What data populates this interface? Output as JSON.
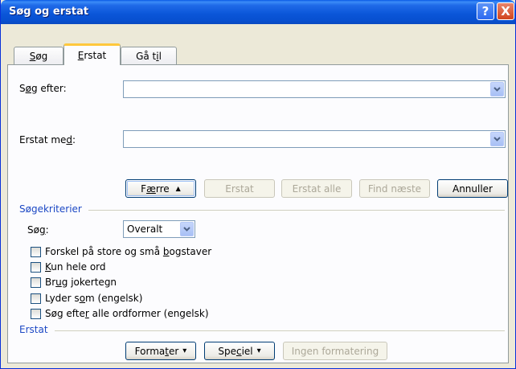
{
  "window": {
    "title": "Søg og erstat",
    "help_symbol": "?",
    "close_symbol": "X"
  },
  "tabs": [
    {
      "label_pre": "",
      "label_u": "S",
      "label_post": "øg"
    },
    {
      "label_pre": "",
      "label_u": "E",
      "label_post": "rstat"
    },
    {
      "label_pre": "Gå t",
      "label_u": "i",
      "label_post": "l"
    }
  ],
  "search": {
    "label_pre": "S",
    "label_u": "ø",
    "label_post": "g efter:",
    "value": ""
  },
  "replace": {
    "label_pre": "Erstat me",
    "label_u": "d",
    "label_post": ":",
    "value": ""
  },
  "buttons": {
    "less_pre": "F",
    "less_u": "æ",
    "less_post": "rre",
    "less_arrow": "▲",
    "replace": "Erstat",
    "replace_all": "Erstat alle",
    "find_next": "Find næste",
    "cancel": "Annuller"
  },
  "criteria": {
    "section_title": "Søgekriterier",
    "search_label_pre": "Sø",
    "search_label_u": "g",
    "search_label_post": ":",
    "search_direction": "Overalt",
    "options": [
      {
        "pre": "Forskel på store og små ",
        "u": "b",
        "post": "ogstaver",
        "checked": false
      },
      {
        "pre": "",
        "u": "K",
        "post": "un hele ord",
        "checked": false
      },
      {
        "pre": "Br",
        "u": "u",
        "post": "g jokertegn",
        "checked": false
      },
      {
        "pre": "Lyder s",
        "u": "o",
        "post": "m (engelsk)",
        "checked": false
      },
      {
        "pre": "Søg efte",
        "u": "r",
        "post": " alle ordformer (engelsk)",
        "checked": false
      }
    ]
  },
  "replace_section": {
    "section_title": "Erstat",
    "format_pre": "Forma",
    "format_u": "t",
    "format_post": "er",
    "special_pre": "Spe",
    "special_u": "c",
    "special_post": "iel",
    "dropdown_arrow": "▾",
    "no_formatting": "Ingen formatering"
  },
  "colors": {
    "titlebar": "#0a55d8",
    "section_title": "#1c48c4",
    "active_tab_accent": "#ffc83c",
    "dialog_bg": "#ece9d8"
  }
}
